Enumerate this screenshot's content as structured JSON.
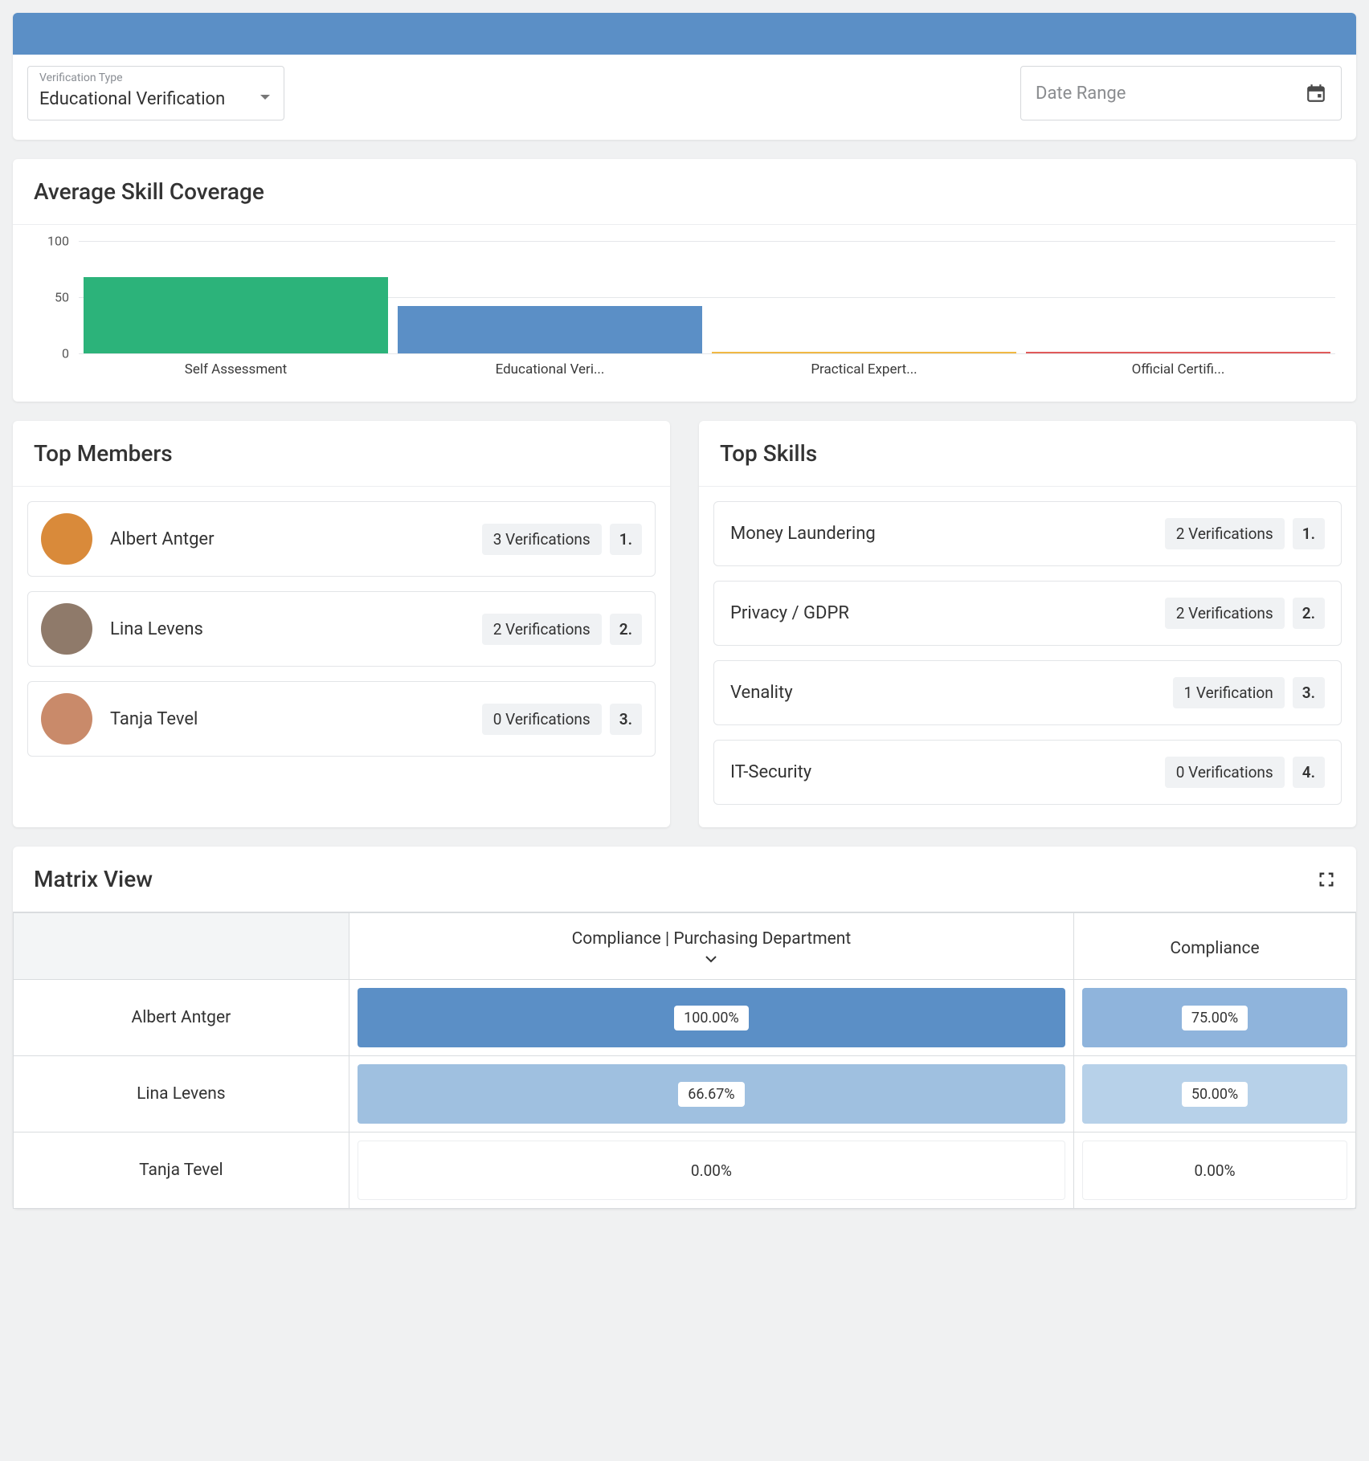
{
  "filters": {
    "verification_type_label": "Verification Type",
    "verification_type_value": "Educational Verification",
    "date_range_placeholder": "Date Range"
  },
  "chart_data": {
    "type": "bar",
    "title": "Average Skill Coverage",
    "categories": [
      "Self Assessment",
      "Educational Veri...",
      "Practical Expert...",
      "Official Certifi..."
    ],
    "values": [
      68,
      42,
      1,
      1
    ],
    "colors": [
      "#2cb37a",
      "#5b8fc6",
      "#f1b844",
      "#e05a5a"
    ],
    "y_ticks": [
      0,
      50,
      100
    ],
    "ylim": [
      0,
      100
    ]
  },
  "top_members": {
    "title": "Top Members",
    "items": [
      {
        "name": "Albert Antger",
        "verifications": "3 Verifications",
        "rank": "1.",
        "avatar_bg": "#d98a3a"
      },
      {
        "name": "Lina Levens",
        "verifications": "2 Verifications",
        "rank": "2.",
        "avatar_bg": "#8f7a6a"
      },
      {
        "name": "Tanja Tevel",
        "verifications": "0 Verifications",
        "rank": "3.",
        "avatar_bg": "#c98a6a"
      }
    ]
  },
  "top_skills": {
    "title": "Top Skills",
    "items": [
      {
        "name": "Money Laundering",
        "verifications": "2 Verifications",
        "rank": "1."
      },
      {
        "name": "Privacy / GDPR",
        "verifications": "2 Verifications",
        "rank": "2."
      },
      {
        "name": "Venality",
        "verifications": "1 Verification",
        "rank": "3."
      },
      {
        "name": "IT-Security",
        "verifications": "0 Verifications",
        "rank": "4."
      }
    ]
  },
  "matrix": {
    "title": "Matrix View",
    "columns": [
      {
        "label": "Compliance | Purchasing Department",
        "expandable": true
      },
      {
        "label": "Compliance",
        "expandable": false
      }
    ],
    "rows": [
      {
        "name": "Albert Antger",
        "cells": [
          {
            "value": "100.00%",
            "bg": "#5b8fc6",
            "filled": true
          },
          {
            "value": "75.00%",
            "bg": "#8fb4dc",
            "filled": true
          }
        ]
      },
      {
        "name": "Lina Levens",
        "cells": [
          {
            "value": "66.67%",
            "bg": "#9fc0e0",
            "filled": true
          },
          {
            "value": "50.00%",
            "bg": "#b7d1e9",
            "filled": true
          }
        ]
      },
      {
        "name": "Tanja Tevel",
        "cells": [
          {
            "value": "0.00%",
            "filled": false
          },
          {
            "value": "0.00%",
            "filled": false
          }
        ]
      }
    ]
  }
}
